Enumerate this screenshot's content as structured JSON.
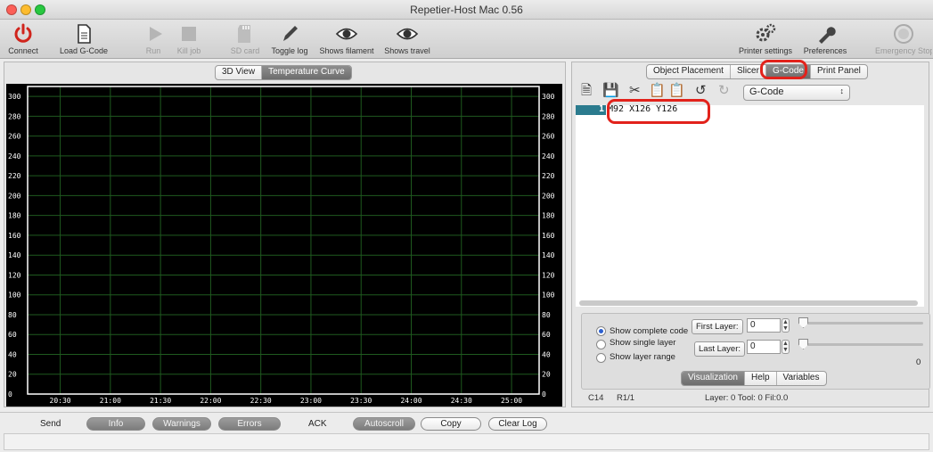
{
  "app": {
    "title": "Repetier-Host Mac 0.56"
  },
  "toolbar": {
    "items": [
      {
        "label": "Connect",
        "icon": "power-icon",
        "enabled": true
      },
      {
        "label": "Load G-Code",
        "icon": "document-icon",
        "enabled": true
      },
      {
        "label": "Run",
        "icon": "play-icon",
        "enabled": false
      },
      {
        "label": "Kill job",
        "icon": "stop-icon",
        "enabled": false
      },
      {
        "label": "SD card",
        "icon": "sd-card-icon",
        "enabled": false
      },
      {
        "label": "Toggle log",
        "icon": "pencil-icon",
        "enabled": true
      },
      {
        "label": "Shows filament",
        "icon": "eye-icon",
        "enabled": true
      },
      {
        "label": "Shows travel",
        "icon": "eye-icon",
        "enabled": true
      },
      {
        "label": "Printer settings",
        "icon": "gears-icon",
        "enabled": true
      },
      {
        "label": "Preferences",
        "icon": "wrench-icon",
        "enabled": true
      },
      {
        "label": "Emergency Stop",
        "icon": "emergency-stop-icon",
        "enabled": false
      }
    ]
  },
  "left_tabs": {
    "items": [
      "3D View",
      "Temperature Curve"
    ],
    "selected": "Temperature Curve"
  },
  "chart_data": {
    "type": "line",
    "title": "",
    "xlabel": "",
    "ylabel": "",
    "x_ticks": [
      "20:30",
      "21:00",
      "21:30",
      "22:00",
      "22:30",
      "23:00",
      "23:30",
      "24:00",
      "24:30",
      "25:00"
    ],
    "y_ticks": [
      0,
      20,
      40,
      60,
      80,
      100,
      120,
      140,
      160,
      180,
      200,
      220,
      240,
      260,
      280,
      300
    ],
    "ylim": [
      0,
      310
    ],
    "grid": true,
    "series": [],
    "colors": {
      "background": "#000000",
      "grid": "#1f5a1f",
      "frame": "#ffffff",
      "text": "#ffffff"
    }
  },
  "right_tabs": {
    "items": [
      "Object Placement",
      "Slicer",
      "G-Code",
      "Print Panel"
    ],
    "selected": "G-Code"
  },
  "editor": {
    "mode_select": "G-Code",
    "lines": [
      {
        "number": "1",
        "text": "M92 X126 Y126"
      }
    ]
  },
  "visualization": {
    "options": [
      "Show complete code",
      "Show single layer",
      "Show layer range"
    ],
    "selected_index": 0,
    "first_layer_label": "First Layer:",
    "first_layer_value": "0",
    "last_layer_label": "Last Layer:",
    "last_layer_value": "0",
    "layer_readout": "0",
    "tabs": [
      "Visualization",
      "Help",
      "Variables"
    ],
    "selected_tab": "Visualization"
  },
  "status": {
    "cursor": "C14",
    "position": "R1/1",
    "layer_info": "Layer: 0 Tool: 0 Fil:0.0"
  },
  "log_bar": {
    "send_label": "Send",
    "info_label": "Info",
    "warnings_label": "Warnings",
    "errors_label": "Errors",
    "ack_label": "ACK",
    "autoscroll_label": "Autoscroll",
    "copy_label": "Copy",
    "clear_label": "Clear Log"
  },
  "colors": {
    "highlight": "#e2221b",
    "gutter": "#2b7b8e",
    "radio_selected": "#2b5fcf"
  }
}
